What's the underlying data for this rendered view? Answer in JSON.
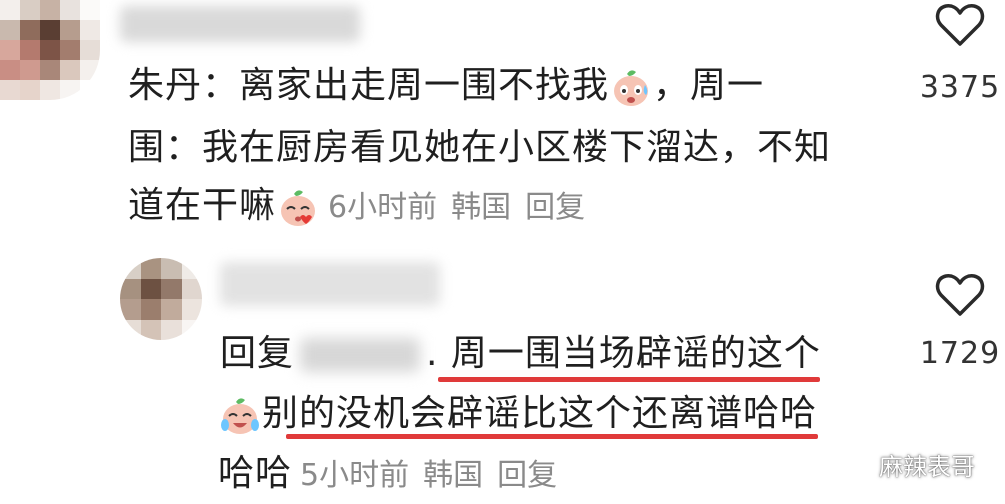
{
  "comment1": {
    "line1": "朱丹：离家出走周一围不找我",
    "line1_tail": "，周一",
    "line2": "围：我在厨房看见她在小区楼下溜达，不知",
    "line3": "道在干嘛",
    "time": "6小时前",
    "location": "韩国",
    "reply": "回复",
    "likes": "3375"
  },
  "comment2": {
    "prefix": "回复",
    "separator": ".",
    "line1": "周一围当场辟谣的这个",
    "line2": "别的没机会辟谣比这个还离谱哈哈",
    "line3": "哈哈",
    "time": "5小时前",
    "location": "韩国",
    "reply": "回复",
    "likes": "1729"
  },
  "watermark": {
    "text": "麻辣表哥"
  },
  "icons": {
    "like": "heart-outline-icon",
    "emoji": "peach-face-emoji-icon",
    "watermark": "wechat-icon"
  },
  "colors": {
    "underline": "#e03a3a",
    "meta": "#8a8a8a"
  }
}
